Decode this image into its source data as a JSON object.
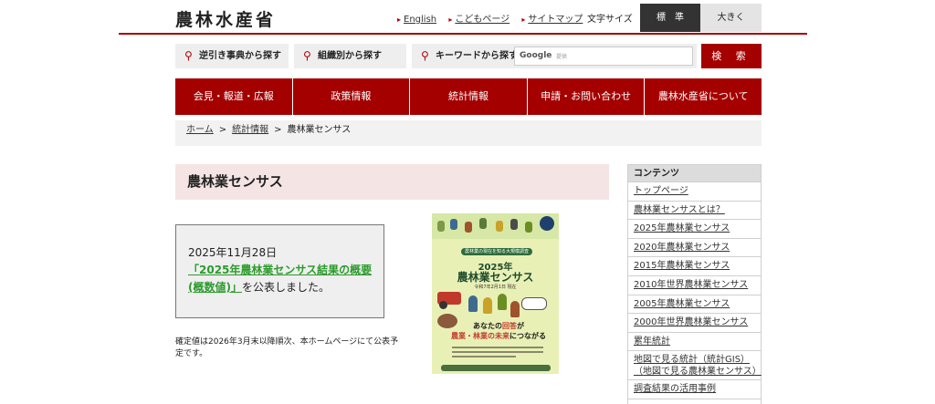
{
  "header": {
    "logo": "農林水産省",
    "util_links": [
      "English",
      "こどもページ",
      "サイトマップ"
    ],
    "font_size_label": "文字サイズ",
    "font_size_standard": "標　準",
    "font_size_large": "大きく"
  },
  "search": {
    "reverse_lookup": "逆引き事典から探す",
    "by_org": "組織別から探す",
    "keyword": "キーワードから探す",
    "google_label": "Google",
    "google_sub": "提供",
    "submit": "検 索"
  },
  "nav": {
    "items": [
      "会見・報道・広報",
      "政策情報",
      "統計情報",
      "申請・お問い合わせ",
      "農林水産省について"
    ]
  },
  "breadcrumb": {
    "home": "ホーム",
    "stats": "統計情報",
    "current": "農林業センサス",
    "sep": ">"
  },
  "page": {
    "title": "農林業センサス",
    "news_date": "2025年11月28日",
    "news_link": "「2025年農林業センサス結果の概要(概数値)」",
    "news_suffix": "を公表しました。",
    "note": "確定値は2026年3月末以降順次、本ホームページにて公表予定です。"
  },
  "poster": {
    "subtitle": "農林業の現在を知る大規模調査",
    "year": "2025年",
    "title": "農林業センサス",
    "date": "令和7年2月1日 現在",
    "msg_1": "あなたの",
    "msg_hl_1": "回答",
    "msg_2": "が",
    "msg_hl_2": "農業・林業の未来",
    "msg_3": "につながる"
  },
  "sidebar": {
    "heading": "コンテンツ",
    "items": [
      "トップページ",
      "農林業センサスとは？",
      "2025年農林業センサス",
      "2020年農林業センサス",
      "2015年農林業センサス",
      "2010年世界農林業センサス",
      "2005年農林業センサス",
      "2000年世界農林業センサス",
      "累年統計"
    ],
    "gis_1": "地図で見る統計（統計GIS）",
    "gis_2": "（地図で見る農林業センサス）",
    "usage": "調査結果の活用事例"
  },
  "colors": {
    "brand_red": "#a40000",
    "link_green": "#2c9b2c",
    "title_band": "#f5e4e4"
  }
}
